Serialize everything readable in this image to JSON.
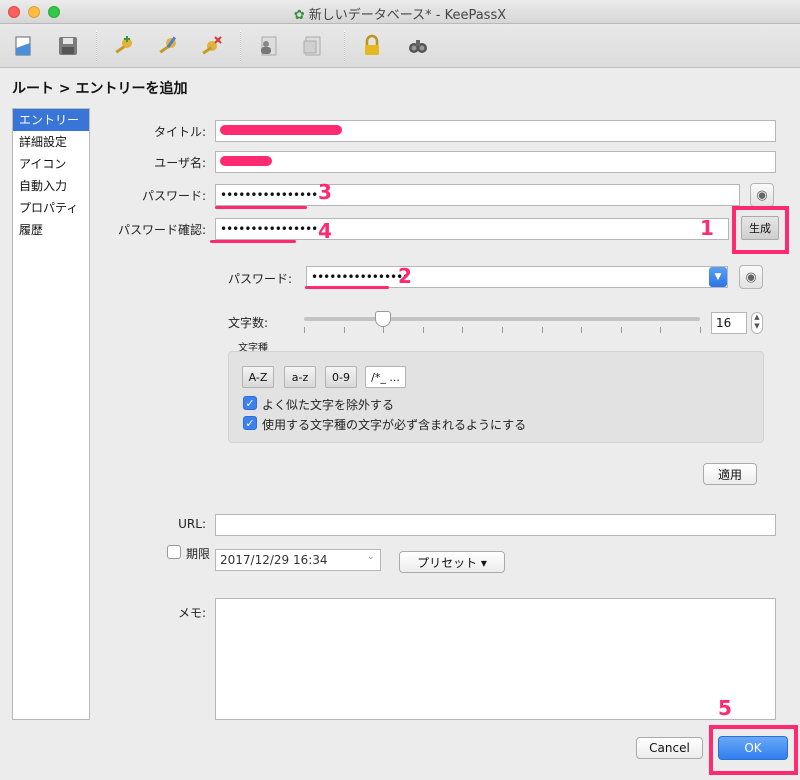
{
  "window": {
    "title": "新しいデータベース* - KeePassX"
  },
  "toolbar": {
    "icons": [
      "new-database-icon",
      "save-icon",
      "add-entry-icon",
      "edit-entry-icon",
      "delete-entry-icon",
      "copy-username-icon",
      "copy-password-icon",
      "lock-icon",
      "search-icon"
    ]
  },
  "breadcrumb": "ルート > エントリーを追加",
  "sidebar": {
    "items": [
      {
        "label": "エントリー",
        "active": true
      },
      {
        "label": "詳細設定"
      },
      {
        "label": "アイコン"
      },
      {
        "label": "自動入力"
      },
      {
        "label": "プロパティ"
      },
      {
        "label": "履歴"
      }
    ]
  },
  "form": {
    "title_label": "タイトル:",
    "username_label": "ユーザ名:",
    "password_label": "パスワード:",
    "password_value": "••••••••••••••••",
    "confirm_label": "パスワード確認:",
    "confirm_value": "••••••••••••••••",
    "generate_label": "生成",
    "url_label": "URL:",
    "expires_label": "期限",
    "expires_value": "2017/12/29 16:34",
    "presets_label": "プリセット ▾",
    "notes_label": "メモ:"
  },
  "generator": {
    "password_label": "パスワード:",
    "password_value": "••••••••••••••••",
    "length_label": "文字数:",
    "length_value": "16",
    "length_fraction": 0.2,
    "charset_title": "文字種",
    "charsets": [
      "A-Z",
      "a-z",
      "0-9",
      "/*_ ..."
    ],
    "exclude_similar_label": "よく似た文字を除外する",
    "pick_from_every_group_label": "使用する文字種の文字が必ず含まれるようにする",
    "apply_label": "適用"
  },
  "annotations": {
    "n1": "1",
    "n2": "2",
    "n3": "3",
    "n4": "4",
    "n5": "5"
  },
  "buttons": {
    "cancel": "Cancel",
    "ok": "OK"
  },
  "colors": {
    "accent": "#ff2a72",
    "selection": "#3875d7",
    "ok_button": "#2f7ef0"
  }
}
